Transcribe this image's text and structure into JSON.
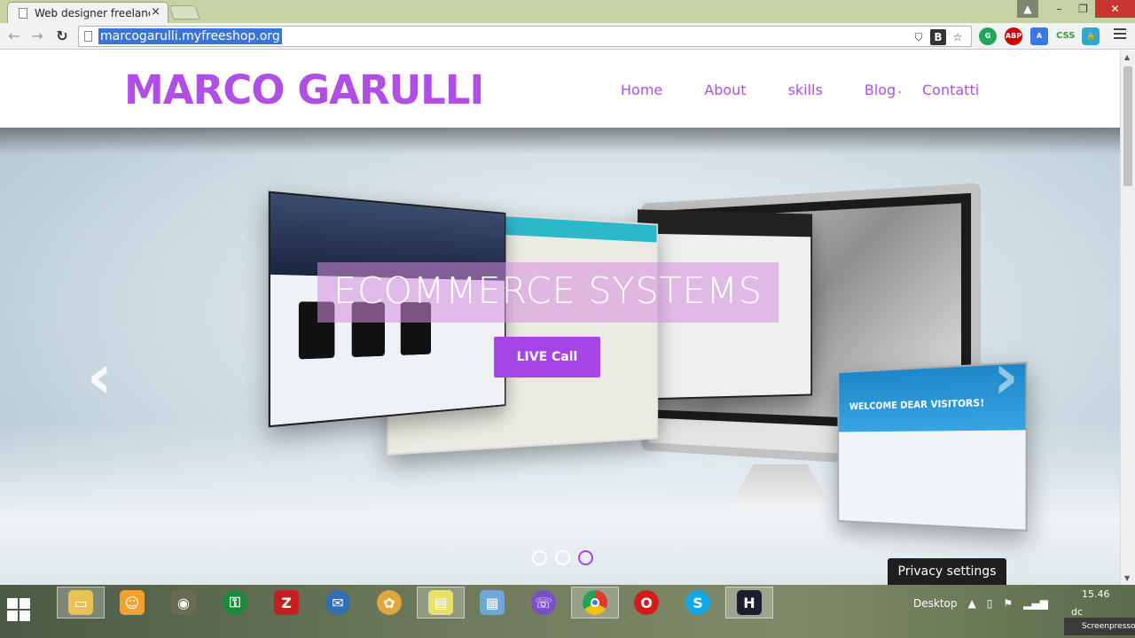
{
  "browser": {
    "tab_title": "Web designer freelance M",
    "tab_close": "×",
    "url": "marcogarulli.myfreeshop.org",
    "omni_icons": [
      "shield",
      "B",
      "☆"
    ],
    "extensions": [
      "G",
      "ABP",
      "A",
      "CSS",
      "🔒"
    ]
  },
  "window": {
    "user": "▲",
    "minimize": "–",
    "restore": "❐",
    "close": "✕"
  },
  "site": {
    "logo": "MARCO GARULLI",
    "nav": [
      "Home",
      "About",
      "skills",
      "Blog",
      ".",
      "Contatti"
    ]
  },
  "hero": {
    "title": "ECOMMERCE SYSTEMS",
    "button": "LIVE Call",
    "prev": "‹",
    "next": "›",
    "screen4_title": "WELCOME DEAR VISITORS!",
    "active_dot": 3
  },
  "cookie": {
    "label": "Privacy settings"
  },
  "taskbar": {
    "tray_desktop": "Desktop",
    "tray_arrow": "▲",
    "time": "15.46",
    "date": "dc",
    "screenpresso": "Screenpresso"
  },
  "colors": {
    "brand": "#b04fe6",
    "button": "#a644e8",
    "url_highlight": "#3875d7"
  }
}
